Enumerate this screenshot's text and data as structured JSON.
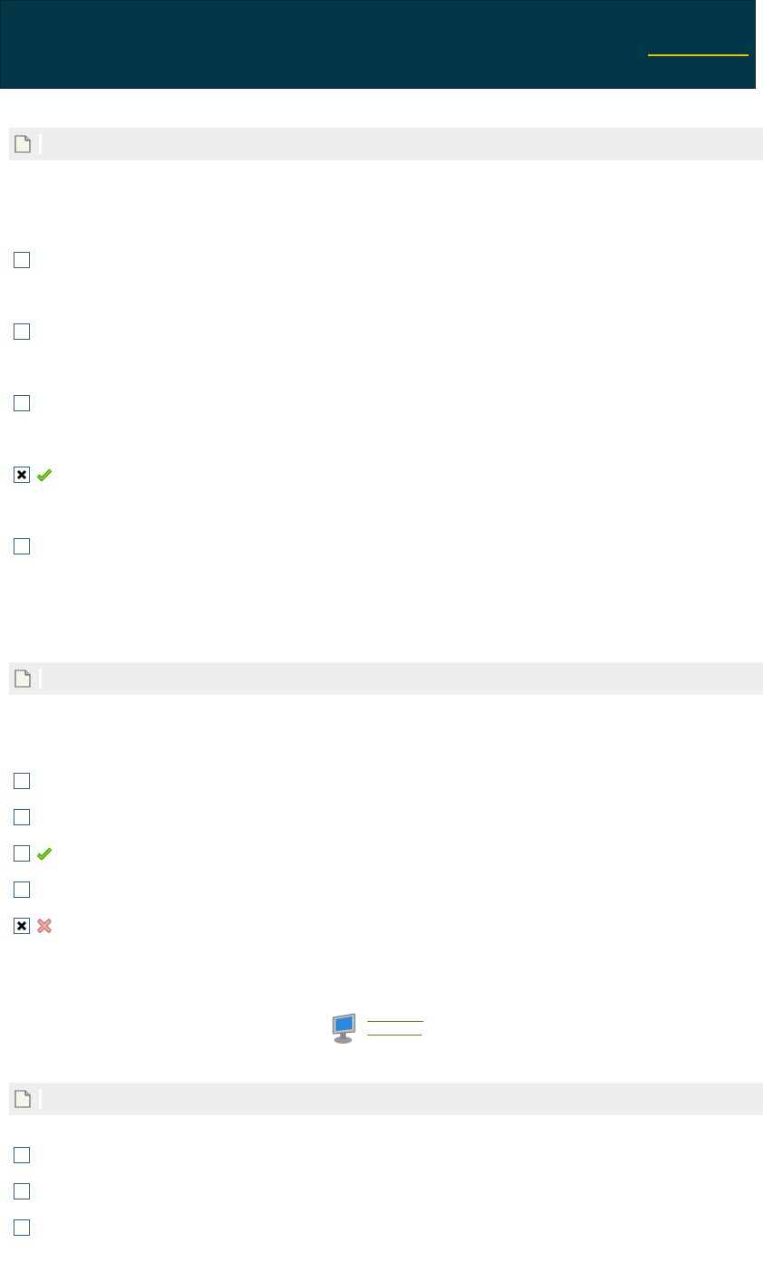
{
  "sections": [
    {
      "items": [
        {
          "checked": false,
          "kind": "plain"
        },
        {
          "checked": false,
          "kind": "plain"
        },
        {
          "checked": false,
          "kind": "plain"
        },
        {
          "checked": true,
          "kind": "correct"
        },
        {
          "checked": false,
          "kind": "plain"
        }
      ]
    },
    {
      "items": [
        {
          "checked": false,
          "kind": "plain"
        },
        {
          "checked": false,
          "kind": "plain"
        },
        {
          "checked": false,
          "kind": "correct"
        },
        {
          "checked": false,
          "kind": "plain"
        },
        {
          "checked": true,
          "kind": "wrong"
        }
      ]
    },
    {
      "items": [
        {
          "checked": false,
          "kind": "plain"
        },
        {
          "checked": false,
          "kind": "plain"
        },
        {
          "checked": false,
          "kind": "plain"
        }
      ]
    }
  ]
}
